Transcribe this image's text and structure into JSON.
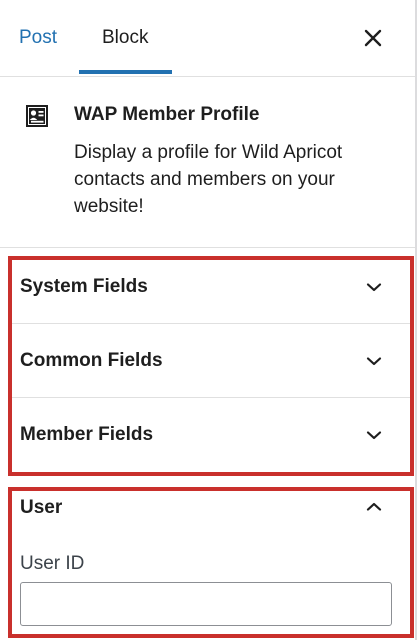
{
  "tabs": {
    "post_label": "Post",
    "block_label": "Block",
    "active": "Block"
  },
  "block": {
    "icon": "member-profile-icon",
    "title": "WAP Member Profile",
    "description": "Display a profile for Wild Apricot contacts and members on your website!"
  },
  "sections": [
    {
      "label": "System Fields",
      "expanded": false,
      "icon": "chevron-down-icon"
    },
    {
      "label": "Common Fields",
      "expanded": false,
      "icon": "chevron-down-icon"
    },
    {
      "label": "Member Fields",
      "expanded": false,
      "icon": "chevron-down-icon"
    }
  ],
  "user_section": {
    "label": "User",
    "expanded": true,
    "icon": "chevron-up-icon",
    "field_label": "User ID",
    "field_value": "",
    "field_placeholder": ""
  },
  "colors": {
    "accent": "#2271b1",
    "highlight": "#c9302c",
    "text": "#1e1e1e",
    "divider": "#e0e0e0"
  }
}
